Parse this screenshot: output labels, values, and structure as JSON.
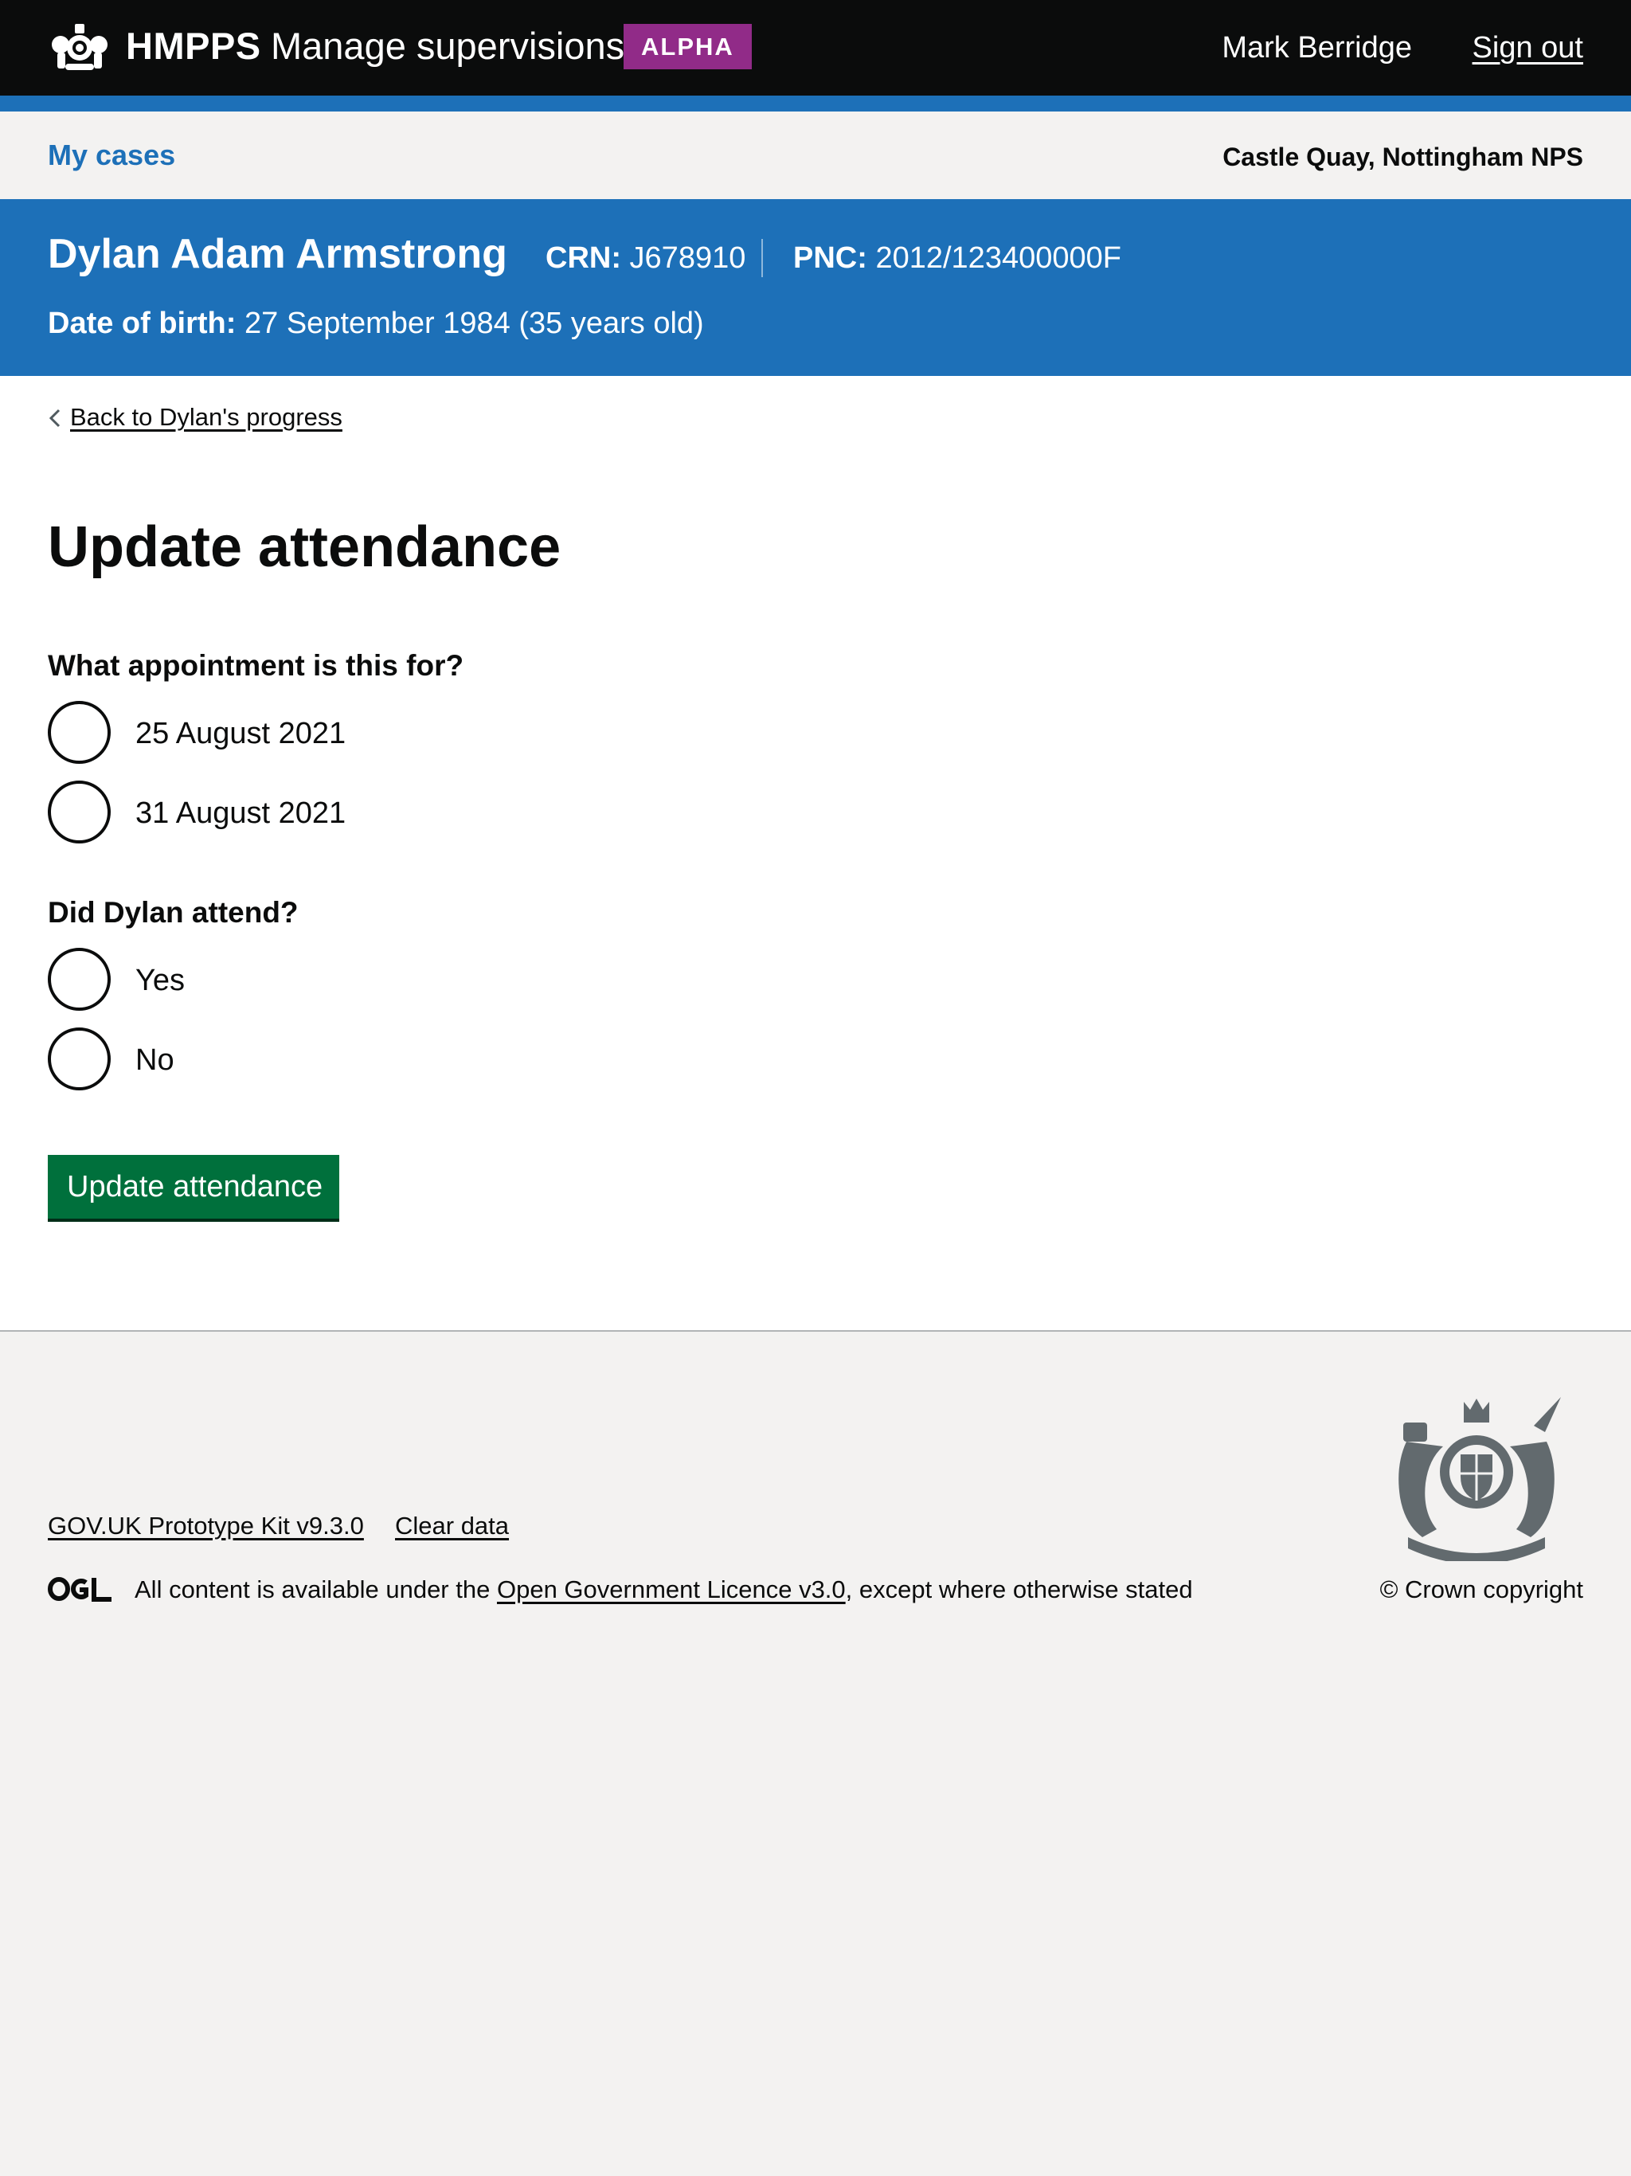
{
  "header": {
    "brand": "HMPPS",
    "service_name": "Manage supervisions",
    "phase_tag": "ALPHA",
    "user_name": "Mark Berridge",
    "sign_out_label": "Sign out",
    "crown_icon": "crown-icon"
  },
  "subnav": {
    "my_cases_label": "My cases",
    "office": "Castle Quay, Nottingham NPS"
  },
  "offender": {
    "name": "Dylan Adam Armstrong",
    "crn_label": "CRN:",
    "crn_value": "J678910",
    "pnc_label": "PNC:",
    "pnc_value": "2012/123400000F",
    "dob_label": "Date of birth:",
    "dob_value": "27 September 1984 (35 years old)"
  },
  "main": {
    "back_link": "Back to Dylan's progress",
    "title": "Update attendance",
    "appointment_question": "What appointment is this for?",
    "appointment_options": [
      "25 August 2021",
      "31 August 2021"
    ],
    "attendance_question": "Did Dylan attend?",
    "attendance_options": [
      "Yes",
      "No"
    ],
    "submit_label": "Update attendance"
  },
  "footer": {
    "links": [
      "GOV.UK Prototype Kit v9.3.0",
      "Clear data"
    ],
    "licence_prefix": "All content is available under the",
    "licence_link": "Open Government Licence v3.0",
    "licence_suffix": ", except where otherwise stated",
    "copyright": "© Crown copyright",
    "ogl_icon": "ogl-logo-icon",
    "crest_icon": "royal-coat-of-arms-icon"
  },
  "colors": {
    "header_bg": "#0b0c0c",
    "brand_blue": "#1d70b8",
    "phase_tag": "#912b88",
    "button_green": "#00703c",
    "footer_bg": "#f3f2f1"
  }
}
